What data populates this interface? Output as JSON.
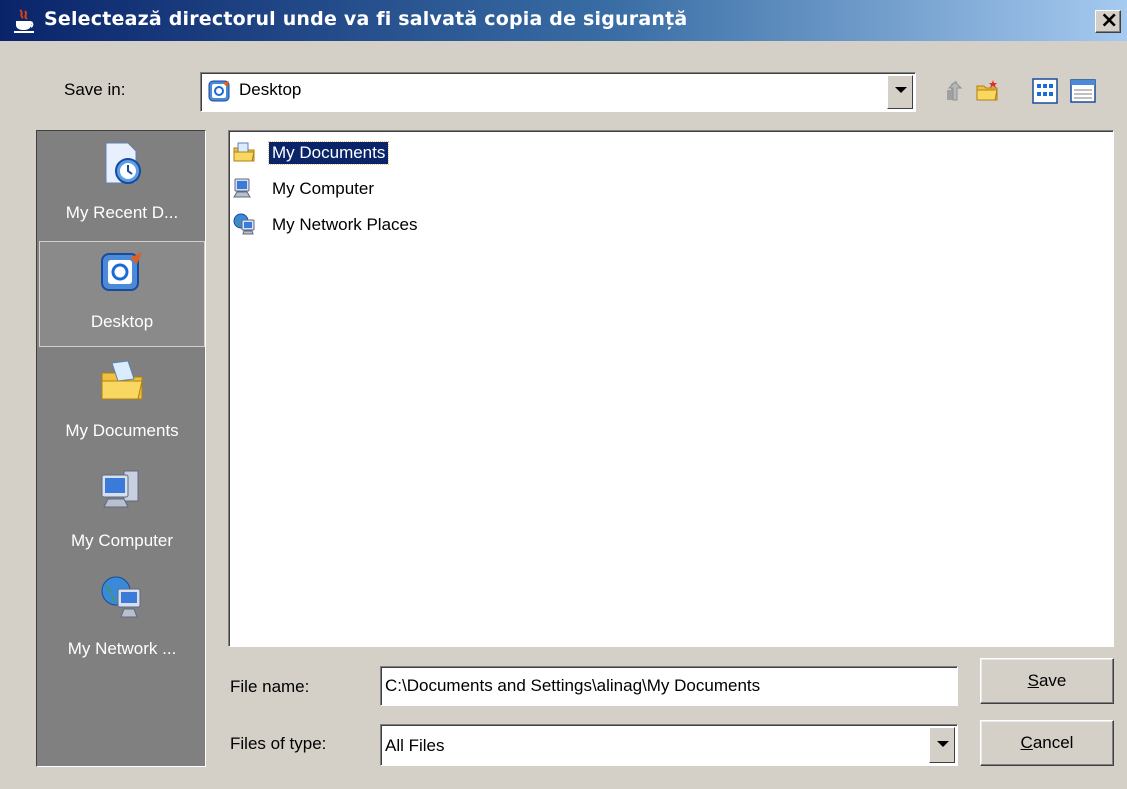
{
  "window": {
    "title": "Selectează directorul unde va fi salvată copia de siguranță",
    "close_glyph": "×",
    "app_icon": "java-cup-icon"
  },
  "save_in": {
    "label": "Save in:",
    "selected": "Desktop",
    "icon": "desktop-icon"
  },
  "toolbar": {
    "buttons": [
      "up-one-level-icon",
      "create-new-folder-icon",
      "list-view-icon",
      "details-view-icon"
    ]
  },
  "places": [
    {
      "label": "My Recent D...",
      "icon": "recent-documents-icon"
    },
    {
      "label": "Desktop",
      "icon": "desktop-icon",
      "selected": true
    },
    {
      "label": "My Documents",
      "icon": "my-documents-icon"
    },
    {
      "label": "My Computer",
      "icon": "my-computer-icon"
    },
    {
      "label": "My Network ...",
      "icon": "my-network-icon"
    }
  ],
  "files": [
    {
      "name": "My Documents",
      "icon": "my-documents-icon",
      "selected": true
    },
    {
      "name": "My Computer",
      "icon": "my-computer-icon"
    },
    {
      "name": "My Network Places",
      "icon": "my-network-icon"
    }
  ],
  "file_name": {
    "label": "File name:",
    "value": "C:\\Documents and Settings\\alinag\\My Documents"
  },
  "files_of_type": {
    "label": "Files of type:",
    "value": "All Files"
  },
  "buttons": {
    "save": {
      "mnemonic": "S",
      "rest": "ave"
    },
    "cancel": {
      "mnemonic": "C",
      "rest": "ancel"
    }
  },
  "colors": {
    "title_start": "#0a246a",
    "title_end": "#a6caf0",
    "selection": "#0a246a",
    "places_bg": "#808080",
    "dialog_bg": "#d4d0c8"
  }
}
